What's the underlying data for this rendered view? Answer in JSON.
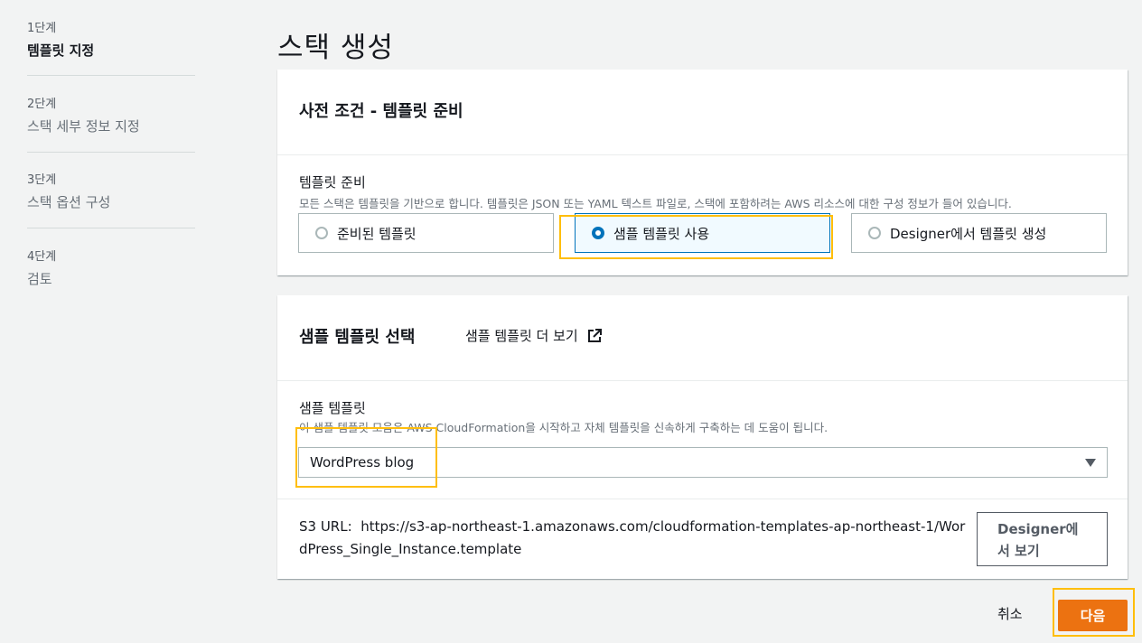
{
  "title": "스택 생성",
  "steps": [
    {
      "num": "1단계",
      "name": "템플릿 지정"
    },
    {
      "num": "2단계",
      "name": "스택 세부 정보 지정"
    },
    {
      "num": "3단계",
      "name": "스택 옵션 구성"
    },
    {
      "num": "4단계",
      "name": "검토"
    }
  ],
  "prereq": {
    "heading": "사전 조건 - 템플릿 준비",
    "label": "템플릿 준비",
    "description": "모든 스택은 템플릿을 기반으로 합니다. 템플릿은 JSON 또는 YAML 텍스트 파일로, 스택에 포함하려는 AWS 리소스에 대한 구성 정보가 들어 있습니다.",
    "options": [
      "준비된 템플릿",
      "샘플 템플릿 사용",
      "Designer에서 템플릿 생성"
    ],
    "selected_index": 1
  },
  "sample": {
    "heading": "샘플 템플릿 선택",
    "more_link": "샘플 템플릿 더 보기",
    "label": "샘플 템플릿",
    "description": "이 샘플 템플릿 모음은 AWS CloudFormation을 시작하고 자체 템플릿을 신속하게 구축하는 데 도움이 됩니다.",
    "selected_value": "WordPress blog",
    "s3_label": "S3 URL:",
    "s3_url": "https://s3-ap-northeast-1.amazonaws.com/cloudformation-templates-ap-northeast-1/WordPress_Single_Instance.template",
    "designer_button": "Designer에서 보기"
  },
  "footer": {
    "cancel": "취소",
    "next": "다음"
  },
  "colors": {
    "accent": "#0073bb",
    "primary_button": "#ec7211",
    "highlight": "#ffbe0b"
  }
}
